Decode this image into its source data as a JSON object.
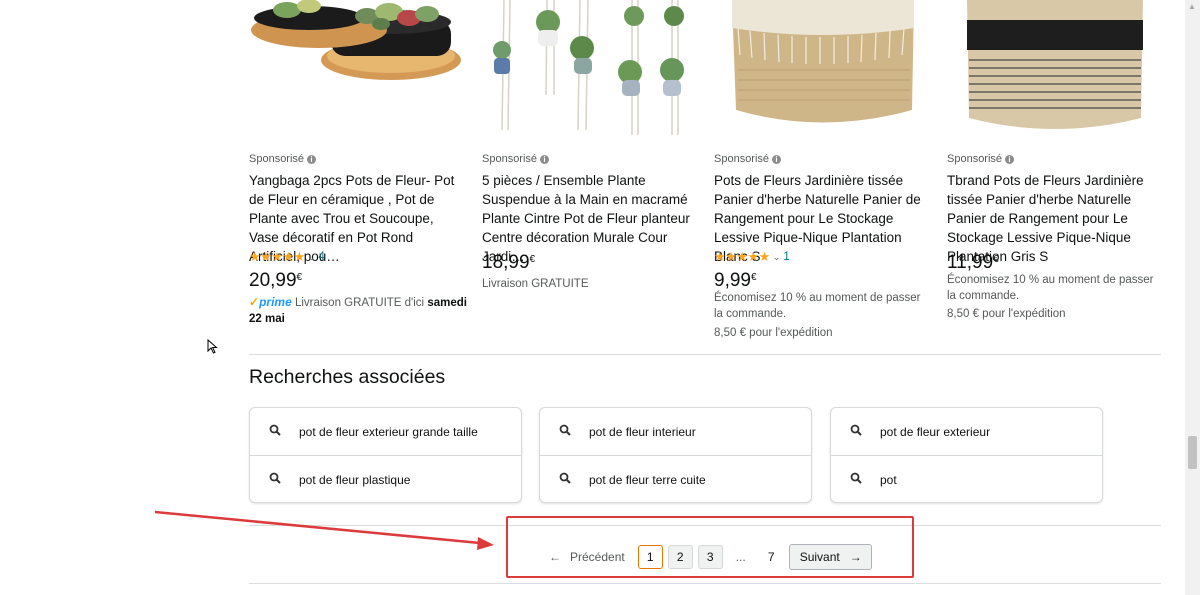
{
  "products": [
    {
      "sponsored": "Sponsorisé",
      "title": "Yangbaga 2pcs Pots de Fleur- Pot de Fleur en céramique , Pot de Plante avec Trou et Soucoupe, Vase décoratif en Pot Rond Artificiel, pou…",
      "rating": 5,
      "stars": "★★★★★",
      "reviews": "4",
      "price_main": "20,99",
      "price_currency": "€",
      "prime_label": "prime",
      "delivery_text": "Livraison GRATUITE d'ici",
      "delivery_bold": "samedi 22 mai"
    },
    {
      "sponsored": "Sponsorisé",
      "title": "5 pièces / Ensemble Plante Suspendue à la Main en macramé Plante Cintre Pot de Fleur planteur Centre décoration Murale Cour Jardi…",
      "price_main": "18,99",
      "price_currency": "€",
      "delivery_text": "Livraison GRATUITE"
    },
    {
      "sponsored": "Sponsorisé",
      "title": "Pots de Fleurs Jardinière tissée Panier d'herbe Naturelle Panier de Rangement pour Le Stockage Lessive Pique-Nique Plantation Blanc S",
      "rating": 5,
      "stars": "★★★★★",
      "reviews": "1",
      "price_main": "9,99",
      "price_currency": "€",
      "savings": "Économisez 10 % au moment de passer la commande.",
      "shipping": "8,50 € pour l'expédition"
    },
    {
      "sponsored": "Sponsorisé",
      "title": "Tbrand Pots de Fleurs Jardinière tissée Panier d'herbe Naturelle Panier de Rangement pour Le Stockage Lessive Pique-Nique Plantation Gris S",
      "price_main": "11,99",
      "price_currency": "€",
      "savings": "Économisez 10 % au moment de passer la commande.",
      "shipping": "8,50 € pour l'expédition"
    }
  ],
  "related": {
    "title": "Recherches associées",
    "items": [
      "pot de fleur exterieur grande taille",
      "pot de fleur plastique",
      "pot de fleur interieur",
      "pot de fleur terre cuite",
      "pot de fleur exterieur",
      "pot"
    ]
  },
  "pagination": {
    "prev_arrow": "←",
    "prev_label": "Précédent",
    "pages": [
      "1",
      "2",
      "3"
    ],
    "current": "1",
    "ellipsis": "...",
    "last": "7",
    "next_label": "Suivant",
    "next_arrow": "→"
  },
  "colors": {
    "annotation": "#dc3b3b",
    "star": "#ffa41c",
    "link": "#007185",
    "prime": "#1a98ff"
  }
}
